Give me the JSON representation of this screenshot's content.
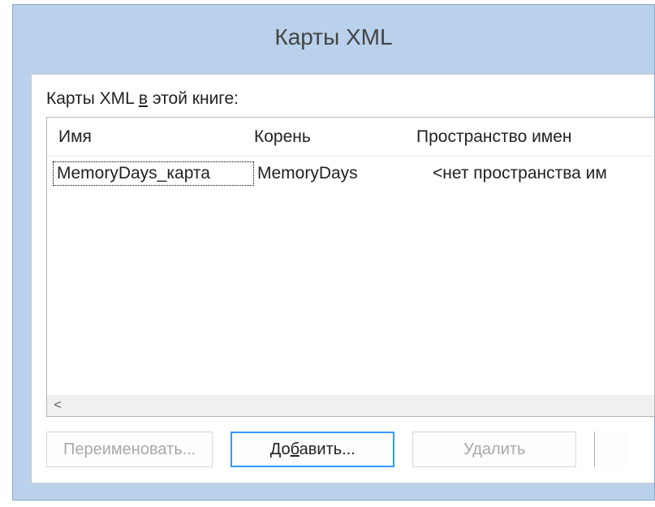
{
  "title": "Карты XML",
  "label_prefix": "Карты XML ",
  "label_ul": "в",
  "label_suffix": " этой книге:",
  "columns": {
    "name": "Имя",
    "root": "Корень",
    "namespace": "Пространство имен"
  },
  "rows": [
    {
      "name": "MemoryDays_карта",
      "root": "MemoryDays",
      "namespace": "<нет пространства им"
    }
  ],
  "buttons": {
    "rename": "Переименовать...",
    "add_pre": "До",
    "add_ul": "б",
    "add_post": "авить...",
    "delete": "Удалить"
  },
  "scroll_left": "<"
}
